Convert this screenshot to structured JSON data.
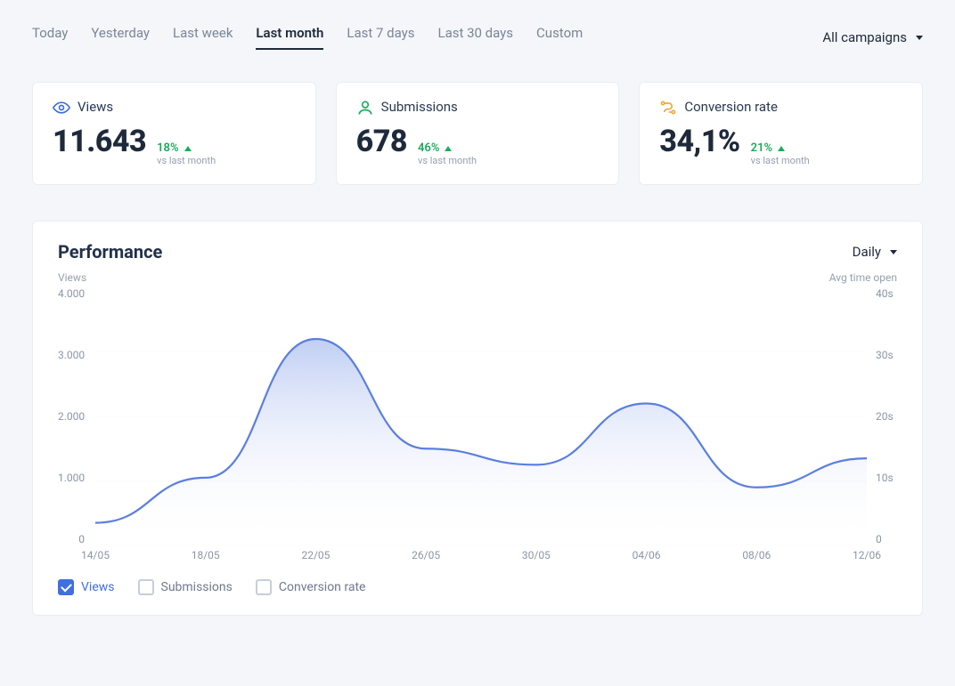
{
  "tabs": [
    "Today",
    "Yesterday",
    "Last week",
    "Last month",
    "Last 7 days",
    "Last 30 days",
    "Custom"
  ],
  "active_tab": "Last month",
  "campaign_filter": "All campaigns",
  "kpis": [
    {
      "title": "Views",
      "value": "11.643",
      "delta": "18%",
      "sub": "vs last month",
      "icon": "eye",
      "icon_color": "#3f6fe0"
    },
    {
      "title": "Submissions",
      "value": "678",
      "delta": "46%",
      "sub": "vs last month",
      "icon": "user",
      "icon_color": "#1aab5a"
    },
    {
      "title": "Conversion rate",
      "value": "34,1%",
      "delta": "21%",
      "sub": "vs last month",
      "icon": "funnel",
      "icon_color": "#f0a83b"
    }
  ],
  "panel": {
    "title": "Performance",
    "granularity": "Daily",
    "left_axis_label": "Views",
    "right_axis_label": "Avg time open",
    "y_left_ticks": [
      "4.000",
      "3.000",
      "2.000",
      "1.000",
      "0"
    ],
    "y_right_ticks": [
      "40s",
      "30s",
      "20s",
      "10s",
      "0"
    ],
    "legend": [
      {
        "label": "Views",
        "checked": true
      },
      {
        "label": "Submissions",
        "checked": false
      },
      {
        "label": "Conversion rate",
        "checked": false
      }
    ]
  },
  "chart_data": {
    "type": "area",
    "title": "Performance",
    "xlabel": "",
    "ylabel": "Views",
    "y2label": "Avg time open",
    "ylim": [
      0,
      4000
    ],
    "y2lim": [
      0,
      40
    ],
    "categories": [
      "14/05",
      "18/05",
      "22/05",
      "26/05",
      "30/05",
      "04/06",
      "08/06",
      "12/06"
    ],
    "series": [
      {
        "name": "Views",
        "values": [
          350,
          1050,
          3200,
          1500,
          1250,
          2200,
          900,
          1350
        ]
      }
    ]
  }
}
